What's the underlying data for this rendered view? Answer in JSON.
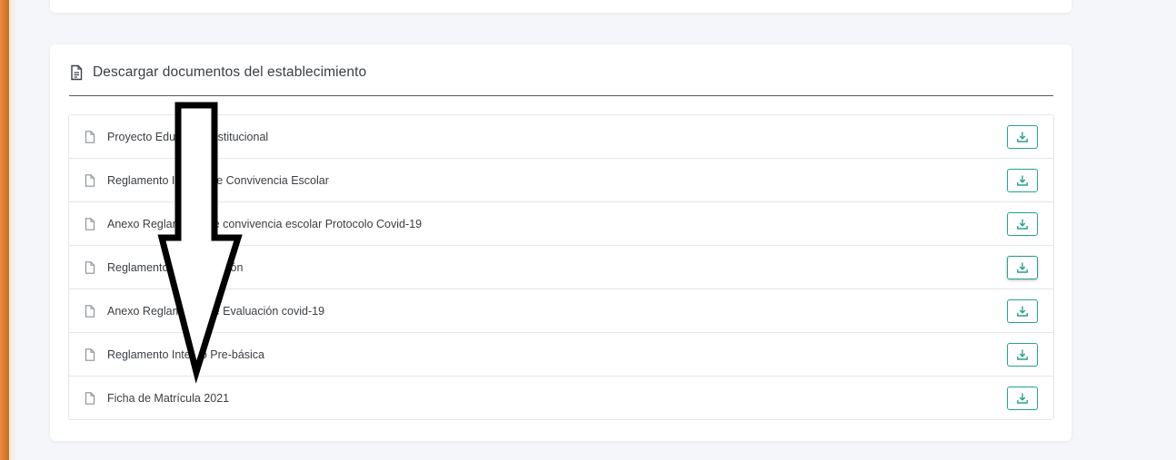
{
  "section": {
    "title": "Descargar documentos del establecimiento",
    "icon": "file-text-icon"
  },
  "documents": [
    {
      "label": "Proyecto Educativo Institucional",
      "icon": "file-icon",
      "action_icon": "download-icon"
    },
    {
      "label": "Reglamento Interno de Convivencia Escolar",
      "icon": "file-icon",
      "action_icon": "download-icon"
    },
    {
      "label": "Anexo Reglamento de convivencia escolar Protocolo Covid-19",
      "icon": "file-icon",
      "action_icon": "download-icon"
    },
    {
      "label": "Reglamento de Evaluación",
      "icon": "file-icon",
      "action_icon": "download-icon"
    },
    {
      "label": "Anexo Reglamento de Evaluación covid-19",
      "icon": "file-icon",
      "action_icon": "download-icon"
    },
    {
      "label": "Reglamento Interno Pre-básica",
      "icon": "file-icon",
      "action_icon": "download-icon"
    },
    {
      "label": "Ficha de Matrícula 2021",
      "icon": "file-icon",
      "action_icon": "download-icon"
    }
  ],
  "colors": {
    "accent_left": "#e98c3c",
    "download_border": "#27a08c",
    "text": "#3a3f44"
  },
  "annotation": {
    "type": "arrow-down",
    "color": "#000000"
  }
}
